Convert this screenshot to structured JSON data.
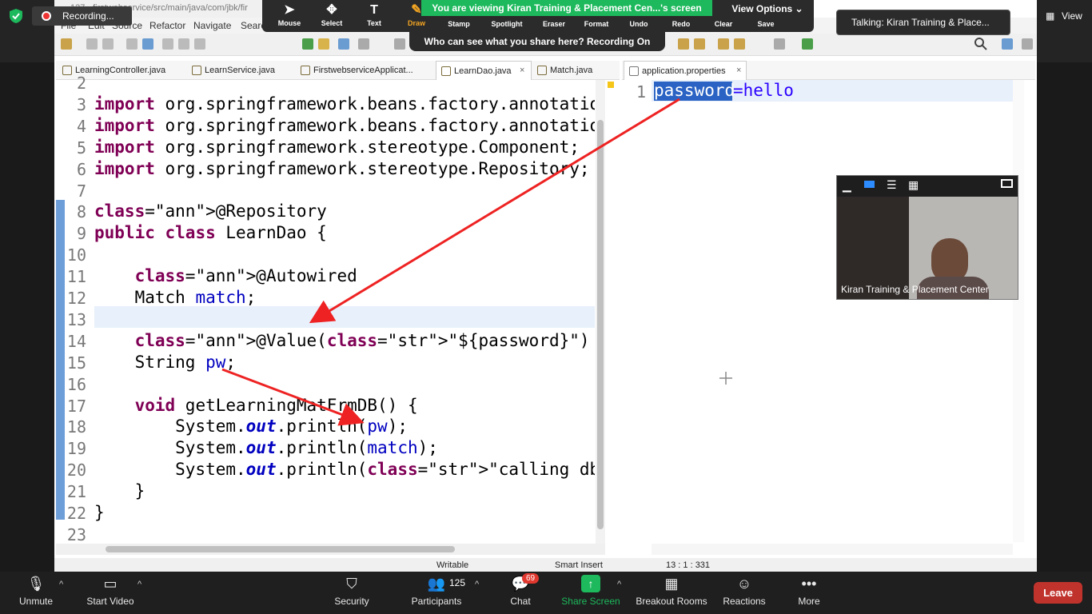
{
  "zoom": {
    "recording_label": "Recording...",
    "viewing_banner": "You are viewing Kiran Training & Placement Cen...'s screen",
    "view_options": "View Options ⌄",
    "who_can_see": "Who can see what you share here? Recording On",
    "talking": "Talking: Kiran Training & Place...",
    "view_button": "View",
    "annotate_tools": [
      "Mouse",
      "Select",
      "Text",
      "Draw",
      "Stamp",
      "Spotlight",
      "Eraser",
      "Format",
      "Undo",
      "Redo",
      "Clear",
      "Save"
    ],
    "video_name": "Kiran Training & Placement Center",
    "bottom": {
      "unmute": "Unmute",
      "start_video": "Start Video",
      "security": "Security",
      "participants": "Participants",
      "participants_count": "125",
      "chat": "Chat",
      "chat_badge": "69",
      "share_screen": "Share Screen",
      "breakout_rooms": "Breakout Rooms",
      "reactions": "Reactions",
      "more": "More",
      "leave": "Leave"
    }
  },
  "eclipse": {
    "title": "127 - firstwebservice/src/main/java/com/jbk/fir",
    "menu": [
      "File",
      "Edit",
      "Source",
      "Refactor",
      "Navigate",
      "Searc"
    ],
    "tabs": [
      "LearningController.java",
      "LearnService.java",
      "FirstwebserviceApplicat...",
      "LearnDao.java",
      "Match.java"
    ],
    "right_tab": "application.properties",
    "code": [
      {
        "n": "2",
        "t": ""
      },
      {
        "n": "3",
        "t": "import org.springframework.beans.factory.annotatio"
      },
      {
        "n": "4",
        "t": "import org.springframework.beans.factory.annotatio"
      },
      {
        "n": "5",
        "t": "import org.springframework.stereotype.Component;"
      },
      {
        "n": "6",
        "t": "import org.springframework.stereotype.Repository;"
      },
      {
        "n": "7",
        "t": ""
      },
      {
        "n": "8",
        "t": "@Repository"
      },
      {
        "n": "9",
        "t": "public class LearnDao {"
      },
      {
        "n": "10",
        "t": ""
      },
      {
        "n": "11",
        "t": "    @Autowired"
      },
      {
        "n": "12",
        "t": "    Match match;"
      },
      {
        "n": "13",
        "t": ""
      },
      {
        "n": "14",
        "t": "    @Value(\"${password}\")"
      },
      {
        "n": "15",
        "t": "    String pw;"
      },
      {
        "n": "16",
        "t": ""
      },
      {
        "n": "17",
        "t": "    void getLearningMatFrmDB() {"
      },
      {
        "n": "18",
        "t": "        System.out.println(pw);"
      },
      {
        "n": "19",
        "t": "        System.out.println(match);"
      },
      {
        "n": "20",
        "t": "        System.out.println(\"calling db by using hi"
      },
      {
        "n": "21",
        "t": "    }"
      },
      {
        "n": "22",
        "t": "}"
      },
      {
        "n": "23",
        "t": ""
      }
    ],
    "props_line_no": "1",
    "props_key": "password",
    "props_rest": "=hello",
    "status": {
      "writable": "Writable",
      "insert": "Smart Insert",
      "position": "13 : 1 : 331"
    }
  }
}
